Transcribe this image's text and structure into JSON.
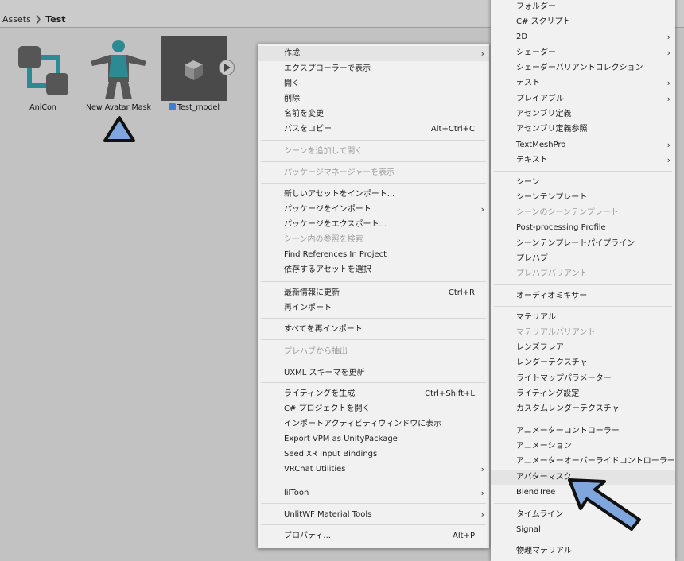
{
  "breadcrumb": {
    "root": "Assets",
    "current": "Test"
  },
  "assets": [
    {
      "label": "AniCon",
      "icon": "animator-controller-icon"
    },
    {
      "label": "New Avatar Mask",
      "icon": "avatar-mask-icon"
    },
    {
      "label": "Test_model",
      "icon": "model-prefab-icon"
    }
  ],
  "context_menu": {
    "items": [
      {
        "label": "作成",
        "shortcut": "",
        "submenu": true,
        "disabled": false
      },
      {
        "label": "エクスプローラーで表示",
        "shortcut": "",
        "submenu": false,
        "disabled": false
      },
      {
        "label": "開く",
        "shortcut": "",
        "submenu": false,
        "disabled": false
      },
      {
        "label": "削除",
        "shortcut": "",
        "submenu": false,
        "disabled": false
      },
      {
        "label": "名前を変更",
        "shortcut": "",
        "submenu": false,
        "disabled": false
      },
      {
        "label": "パスをコピー",
        "shortcut": "Alt+Ctrl+C",
        "submenu": false,
        "disabled": false
      },
      {
        "label": "シーンを追加して開く",
        "shortcut": "",
        "submenu": false,
        "disabled": true
      },
      {
        "label": "パッケージマネージャーを表示",
        "shortcut": "",
        "submenu": false,
        "disabled": true
      },
      {
        "label": "新しいアセットをインポート...",
        "shortcut": "",
        "submenu": false,
        "disabled": false
      },
      {
        "label": "パッケージをインポート",
        "shortcut": "",
        "submenu": true,
        "disabled": false
      },
      {
        "label": "パッケージをエクスポート...",
        "shortcut": "",
        "submenu": false,
        "disabled": false
      },
      {
        "label": "シーン内の参照を検索",
        "shortcut": "",
        "submenu": false,
        "disabled": true
      },
      {
        "label": "Find References In Project",
        "shortcut": "",
        "submenu": false,
        "disabled": false
      },
      {
        "label": "依存するアセットを選択",
        "shortcut": "",
        "submenu": false,
        "disabled": false
      },
      {
        "label": "最新情報に更新",
        "shortcut": "Ctrl+R",
        "submenu": false,
        "disabled": false
      },
      {
        "label": "再インポート",
        "shortcut": "",
        "submenu": false,
        "disabled": false
      },
      {
        "label": "すべてを再インポート",
        "shortcut": "",
        "submenu": false,
        "disabled": false
      },
      {
        "label": "プレハブから抽出",
        "shortcut": "",
        "submenu": false,
        "disabled": true
      },
      {
        "label": "UXML スキーマを更新",
        "shortcut": "",
        "submenu": false,
        "disabled": false
      },
      {
        "label": "ライティングを生成",
        "shortcut": "Ctrl+Shift+L",
        "submenu": false,
        "disabled": false
      },
      {
        "label": "C# プロジェクトを開く",
        "shortcut": "",
        "submenu": false,
        "disabled": false
      },
      {
        "label": "インポートアクティビティウィンドウに表示",
        "shortcut": "",
        "submenu": false,
        "disabled": false
      },
      {
        "label": "Export VPM as UnityPackage",
        "shortcut": "",
        "submenu": false,
        "disabled": false
      },
      {
        "label": "Seed XR Input Bindings",
        "shortcut": "",
        "submenu": false,
        "disabled": false
      },
      {
        "label": "VRChat Utilities",
        "shortcut": "",
        "submenu": true,
        "disabled": false
      },
      {
        "label": "lilToon",
        "shortcut": "",
        "submenu": true,
        "disabled": false
      },
      {
        "label": "UnlitWF Material Tools",
        "shortcut": "",
        "submenu": true,
        "disabled": false
      },
      {
        "label": "プロパティ...",
        "shortcut": "Alt+P",
        "submenu": false,
        "disabled": false
      }
    ]
  },
  "create_submenu": {
    "items": [
      {
        "label": "フォルダー",
        "submenu": false,
        "disabled": false
      },
      {
        "label": "C# スクリプト",
        "submenu": false,
        "disabled": false
      },
      {
        "label": "2D",
        "submenu": true,
        "disabled": false
      },
      {
        "label": "シェーダー",
        "submenu": true,
        "disabled": false
      },
      {
        "label": "シェーダーバリアントコレクション",
        "submenu": false,
        "disabled": false
      },
      {
        "label": "テスト",
        "submenu": true,
        "disabled": false
      },
      {
        "label": "プレイアブル",
        "submenu": true,
        "disabled": false
      },
      {
        "label": "アセンブリ定義",
        "submenu": false,
        "disabled": false
      },
      {
        "label": "アセンブリ定義参照",
        "submenu": false,
        "disabled": false
      },
      {
        "label": "TextMeshPro",
        "submenu": true,
        "disabled": false
      },
      {
        "label": "テキスト",
        "submenu": true,
        "disabled": false
      },
      {
        "label": "シーン",
        "submenu": false,
        "disabled": false
      },
      {
        "label": "シーンテンプレート",
        "submenu": false,
        "disabled": false
      },
      {
        "label": "シーンのシーンテンプレート",
        "submenu": false,
        "disabled": true
      },
      {
        "label": "Post-processing Profile",
        "submenu": false,
        "disabled": false
      },
      {
        "label": "シーンテンプレートパイプライン",
        "submenu": false,
        "disabled": false
      },
      {
        "label": "プレハブ",
        "submenu": false,
        "disabled": false
      },
      {
        "label": "プレハブバリアント",
        "submenu": false,
        "disabled": true
      },
      {
        "label": "オーディオミキサー",
        "submenu": false,
        "disabled": false
      },
      {
        "label": "マテリアル",
        "submenu": false,
        "disabled": false
      },
      {
        "label": "マテリアルバリアント",
        "submenu": false,
        "disabled": true
      },
      {
        "label": "レンズフレア",
        "submenu": false,
        "disabled": false
      },
      {
        "label": "レンダーテクスチャ",
        "submenu": false,
        "disabled": false
      },
      {
        "label": "ライトマップパラメーター",
        "submenu": false,
        "disabled": false
      },
      {
        "label": "ライティング設定",
        "submenu": false,
        "disabled": false
      },
      {
        "label": "カスタムレンダーテクスチャ",
        "submenu": false,
        "disabled": false
      },
      {
        "label": "アニメーターコントローラー",
        "submenu": false,
        "disabled": false
      },
      {
        "label": "アニメーション",
        "submenu": false,
        "disabled": false
      },
      {
        "label": "アニメーターオーバーライドコントローラー",
        "submenu": false,
        "disabled": false
      },
      {
        "label": "アバターマスク",
        "submenu": false,
        "disabled": false
      },
      {
        "label": "BlendTree",
        "submenu": false,
        "disabled": false
      },
      {
        "label": "タイムライン",
        "submenu": false,
        "disabled": false
      },
      {
        "label": "Signal",
        "submenu": false,
        "disabled": false
      },
      {
        "label": "物理マテリアル",
        "submenu": false,
        "disabled": false
      }
    ]
  },
  "colors": {
    "accent_blue": "#7fa6dd",
    "teal": "#2c8a93",
    "icon_gray": "#565656"
  }
}
